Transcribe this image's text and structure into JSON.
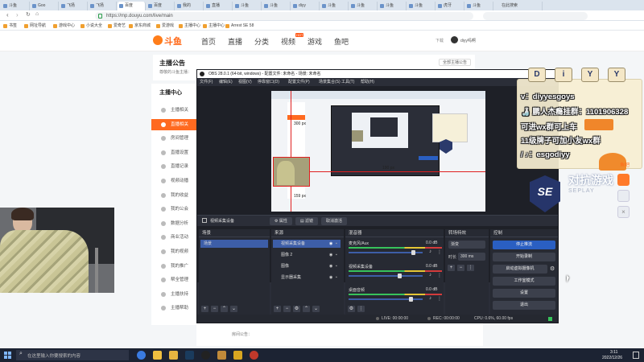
{
  "browser": {
    "tabs": [
      "斗鱼",
      "Goo",
      "飞扬",
      "飞扬",
      "百度",
      "百度",
      "我的",
      "直播",
      "斗鱼",
      "斗鱼",
      "diyy",
      "斗鱼",
      "斗鱼",
      "斗鱼",
      "斗鱼",
      "虎牙",
      "斗鱼"
    ],
    "active_tab": 4,
    "new_tab_search": "在此搜索",
    "url": "https://mp.douyu.com/live/main",
    "bookmarks": [
      "书签",
      "网址导航",
      "游戏中心",
      "小说大全",
      "爱奇艺",
      "京东商城",
      "爱游戏",
      "主播中心",
      "主播中心",
      "Arrest SE 58"
    ]
  },
  "douyu": {
    "logo_text": "斗鱼",
    "nav": [
      "首页",
      "直播",
      "分类",
      "视频",
      "游戏",
      "鱼吧"
    ],
    "hot_badge": "HOT",
    "download": "下载",
    "username": "diyy吗啊",
    "notice_title": "主播公告",
    "notice_body": "尊敬的斗鱼主播：",
    "all_notices": "全部主播公告",
    "sidebar_title": "主播中心",
    "sidebar": [
      "主播相关",
      "直播相关",
      "房间管理",
      "直播设置",
      "直播记录",
      "视频动播",
      "我的收益",
      "我的公会",
      "数据分析",
      "商业活动",
      "我的视频",
      "我的推广",
      "帮全管理",
      "主播扶持",
      "主播帮助"
    ],
    "sidebar_active": 1,
    "room_notice_label": "房间公告：",
    "brand_side": "对抗游戏",
    "brand_side2": "SEPLAY"
  },
  "obs": {
    "title": "OBS 28.0.1 (64-bit, windows) - 配置文件: 未命名 - 场景: 未命名",
    "menu": [
      "文件(F)",
      "编辑(E)",
      "视图(V)",
      "停靠窗口(D)",
      "配置文件(P)",
      "场景集合(S)",
      "工具(T)",
      "帮助(H)"
    ],
    "source_bar": {
      "source_name": "视频采集设备",
      "properties": "属性",
      "filters": "滤镜",
      "deactivate": "取消激活"
    },
    "preview_labels": [
      "300 px",
      "190 px",
      "159 px"
    ],
    "scenes": {
      "title": "场景",
      "items": [
        "场景"
      ]
    },
    "sources": {
      "title": "来源",
      "items": [
        "视频采集设备",
        "图像 2",
        "图像",
        "显示器采集"
      ]
    },
    "mixer": {
      "title": "混音器",
      "channels": [
        {
          "name": "麦克风/Aux",
          "db": "0.0 dB",
          "level": 0.88
        },
        {
          "name": "视频采集设备",
          "db": "0.0 dB",
          "level": 0.7
        },
        {
          "name": "桌面音频",
          "db": "0.0 dB",
          "level": 0.85
        }
      ]
    },
    "transitions": {
      "title": "转场特效",
      "type": "渐变",
      "duration_label": "时长",
      "duration": "300 ms"
    },
    "controls": {
      "title": "控制",
      "buttons": [
        "停止推流",
        "开始录制",
        "启动虚拟摄像机",
        "工作室模式",
        "设置",
        "退出"
      ]
    },
    "status": {
      "live": "LIVE: 00:00:00",
      "rec": "REC: 00:00:00",
      "cpu": "CPU: 0.6%, 60.00 fps"
    }
  },
  "overlay": {
    "initials": [
      "D",
      "i",
      "Y",
      "Y"
    ],
    "lines": [
      "v：diyyesgoys",
      "🍶 鹏人杰瘾挂群：1101906328",
      "可进wx群可上车",
      "11级牌子可加小友wx群",
      "/ ♪：esgodiyy"
    ],
    "channel_logo": "SE",
    "fish_label": "鱼吧"
  },
  "taskbar": {
    "search_placeholder": "在这里输入你要搜索的内容",
    "time": "3:11",
    "date": "2022/12/26"
  }
}
